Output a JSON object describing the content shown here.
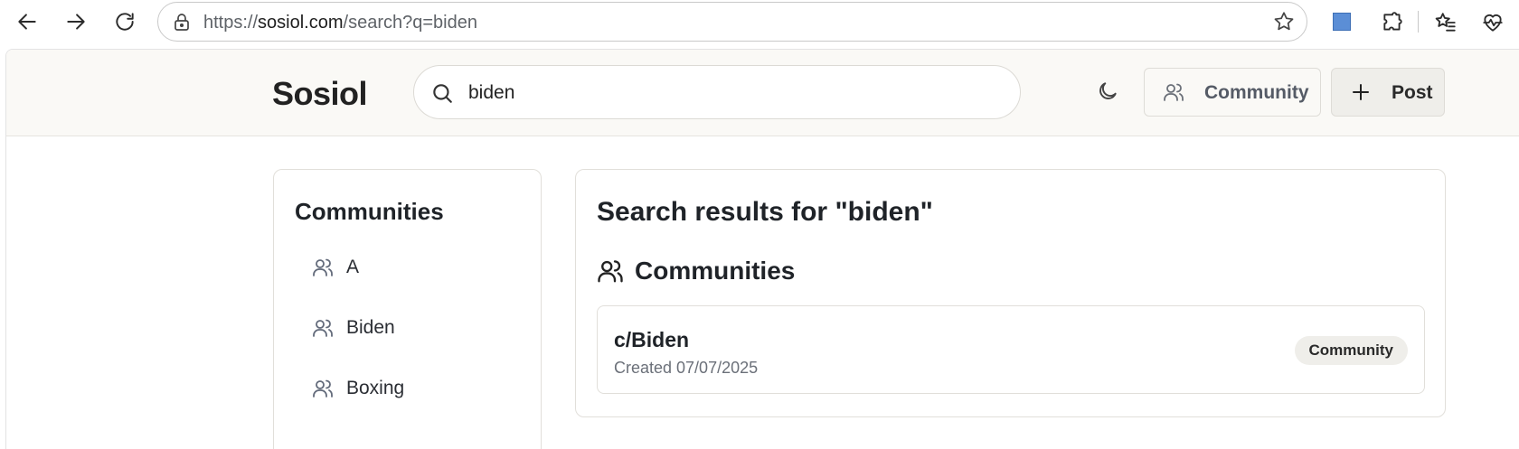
{
  "browser": {
    "url_scheme": "https://",
    "url_host": "sosiol.com",
    "url_path": "/search?q=biden"
  },
  "header": {
    "logo": "Sosiol",
    "search_value": "biden",
    "community_button": "Community",
    "post_button": "Post"
  },
  "sidebar": {
    "title": "Communities",
    "items": [
      {
        "label": "A"
      },
      {
        "label": "Biden"
      },
      {
        "label": "Boxing"
      }
    ]
  },
  "results": {
    "title": "Search results for \"biden\"",
    "section_title": "Communities",
    "items": [
      {
        "name": "c/Biden",
        "meta": "Created 07/07/2025",
        "badge": "Community"
      }
    ]
  },
  "icons": {
    "back": "arrow-left-icon",
    "forward": "arrow-right-icon",
    "reload": "reload-icon",
    "lock": "lock-icon",
    "favorite": "star-icon",
    "extensions": "puzzle-icon",
    "favorites": "favorites-list-icon",
    "health": "heart-pulse-icon",
    "search": "search-icon",
    "theme": "moon-icon",
    "users": "users-icon",
    "plus": "plus-icon"
  },
  "colors": {
    "header_bg": "#faf9f6",
    "extension_square": "#5b8ed6",
    "badge_bg": "#efeeea"
  }
}
